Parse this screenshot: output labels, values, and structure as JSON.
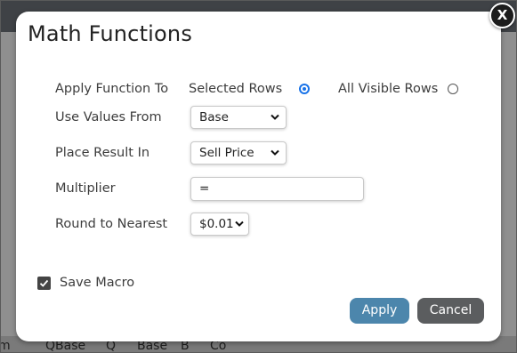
{
  "background": {
    "columns": [
      "m",
      "QBase",
      "Q",
      "Base",
      "B",
      "Co"
    ]
  },
  "dialog": {
    "title": "Math Functions",
    "close_label": "X",
    "apply_function_to": {
      "label": "Apply Function To",
      "options": [
        {
          "label": "Selected Rows",
          "selected": true
        },
        {
          "label": "All Visible Rows",
          "selected": false
        }
      ]
    },
    "use_values_from": {
      "label": "Use Values From",
      "value": "Base"
    },
    "place_result_in": {
      "label": "Place Result In",
      "value": "Sell Price"
    },
    "multiplier": {
      "label": "Multiplier",
      "value": "="
    },
    "round_to_nearest": {
      "label": "Round to Nearest",
      "value": "$0.01"
    },
    "save_macro": {
      "label": "Save Macro",
      "checked": true
    },
    "buttons": {
      "apply": "Apply",
      "cancel": "Cancel"
    }
  },
  "colors": {
    "apply_button": "#4c86ac",
    "cancel_button": "#5b5d5f",
    "radio_selected": "#1a73e8"
  }
}
